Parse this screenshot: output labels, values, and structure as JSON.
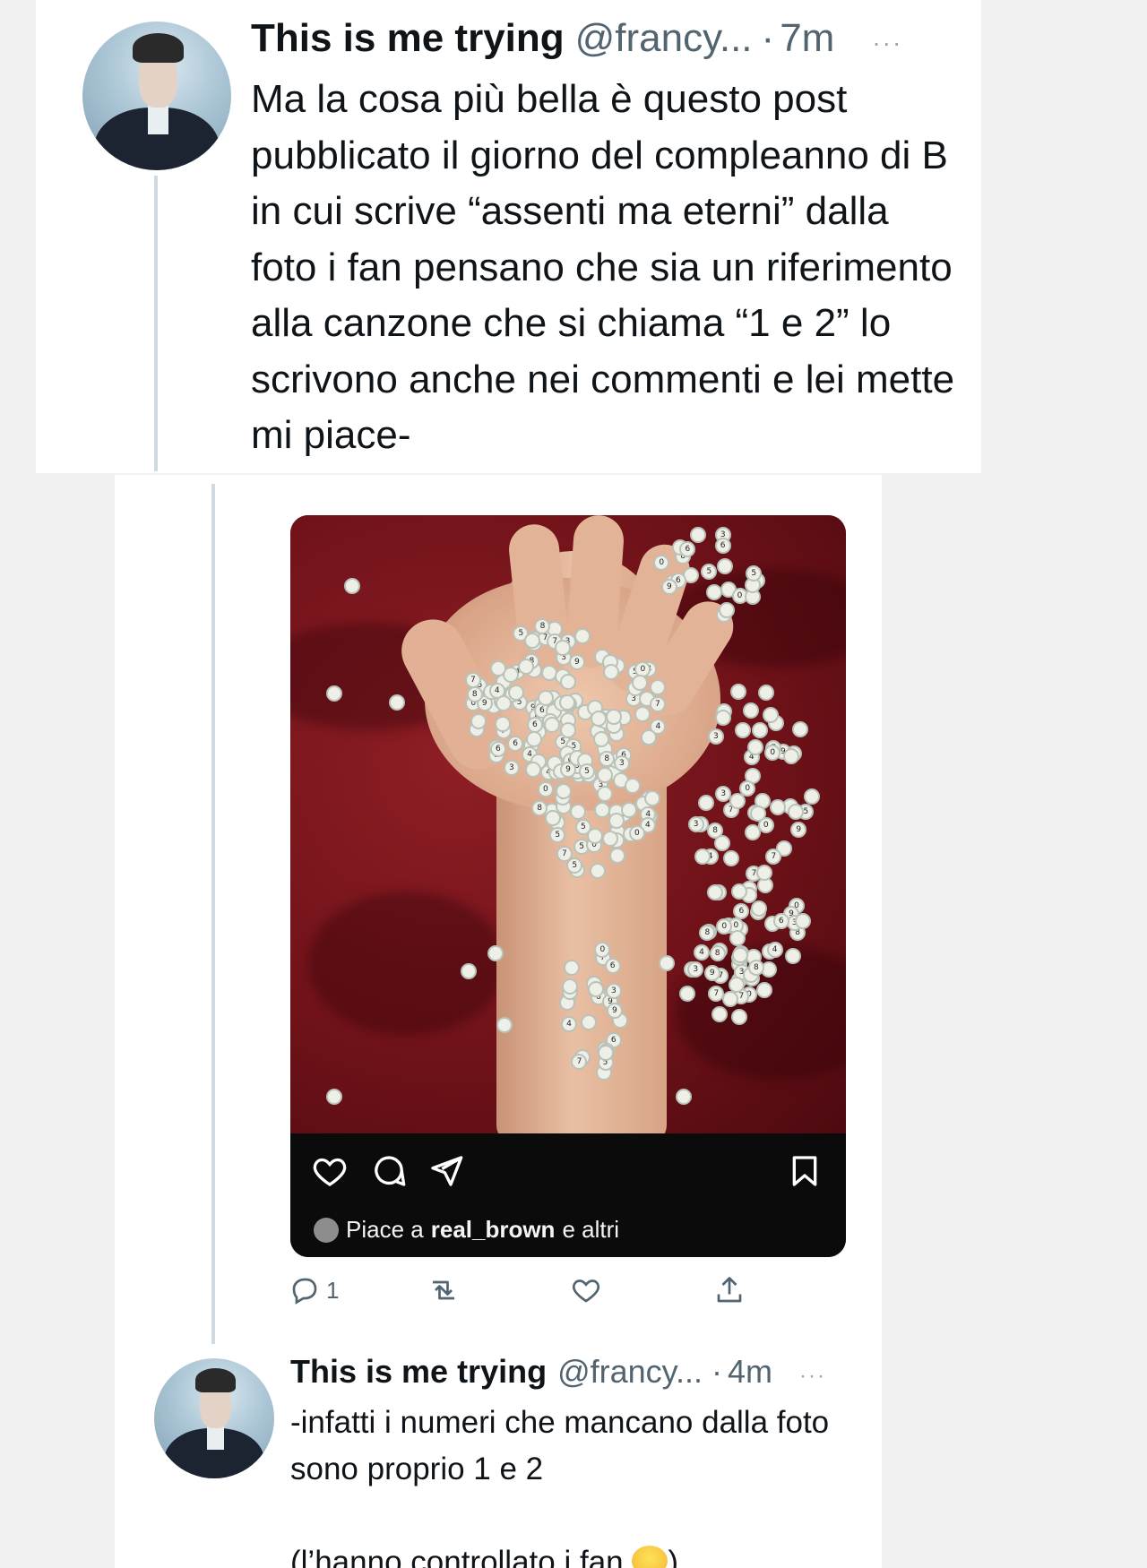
{
  "colors": {
    "text": "#0f1419",
    "muted": "#536471",
    "thread_line": "#cfd9de",
    "ig_bar": "#0b0b0b"
  },
  "tweet_1": {
    "display_name": "This is me trying",
    "handle": "@francy...",
    "separator": "·",
    "time": "7m",
    "more": "···",
    "text": "Ma la cosa più bella è questo post pubblicato il giorno del compleanno di B in cui scrive “assenti ma eterni” dalla foto i fan pensano che sia un riferimento alla canzone che si chiama “1 e 2” lo scrivono anche nei commenti e lei mette mi piace-"
  },
  "instagram_post": {
    "likes_prefix": "Piace a",
    "likes_user": "real_brown",
    "likes_suffix": "e altri",
    "icons": [
      "heart-icon",
      "comment-icon",
      "share-icon",
      "bookmark-icon"
    ]
  },
  "tweet_actions": {
    "reply_count": "1",
    "icons": [
      "reply-icon",
      "retweet-icon",
      "like-icon",
      "share-icon"
    ]
  },
  "tweet_2": {
    "display_name": "This is me trying",
    "handle": "@francy...",
    "separator": "·",
    "time": "4m",
    "more": "···",
    "text": "-infatti i numeri che mancano dalla foto sono proprio 1 e 2\n\n(l’hanno controllato i fan ",
    "text_end": ")",
    "emoji": "face-with-tears-of-joy"
  }
}
